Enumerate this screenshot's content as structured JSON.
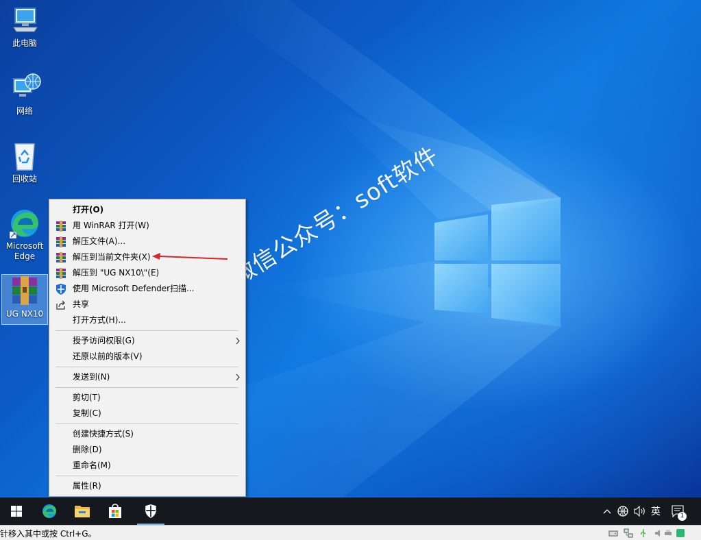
{
  "desktop": {
    "icons": [
      {
        "label": "此电脑",
        "icon": "this-pc-icon"
      },
      {
        "label": "网络",
        "icon": "network-icon"
      },
      {
        "label": "回收站",
        "icon": "recycle-bin-icon"
      },
      {
        "label": "Microsoft Edge",
        "icon": "edge-icon"
      },
      {
        "label": "UG NX10",
        "icon": "winrar-archive-icon"
      }
    ],
    "watermark": "微信公众号：soft软件"
  },
  "context_menu": {
    "items": [
      {
        "label": "打开(O)"
      },
      {
        "label": "用 WinRAR 打开(W)",
        "icon": "winrar-icon"
      },
      {
        "label": "解压文件(A)...",
        "icon": "winrar-icon"
      },
      {
        "label": "解压到当前文件夹(X)",
        "icon": "winrar-icon"
      },
      {
        "label": "解压到 \"UG NX10\\\"(E)",
        "icon": "winrar-icon"
      },
      {
        "label": "使用 Microsoft Defender扫描...",
        "icon": "defender-shield-icon"
      },
      {
        "label": "共享",
        "icon": "share-icon"
      },
      {
        "label": "打开方式(H)..."
      },
      {
        "label": "授予访问权限(G)",
        "submenu": true
      },
      {
        "label": "还原以前的版本(V)"
      },
      {
        "label": "发送到(N)",
        "submenu": true
      },
      {
        "label": "剪切(T)"
      },
      {
        "label": "复制(C)"
      },
      {
        "label": "创建快捷方式(S)"
      },
      {
        "label": "删除(D)"
      },
      {
        "label": "重命名(M)"
      },
      {
        "label": "属性(R)"
      }
    ]
  },
  "taskbar": {
    "buttons": [
      "start-icon",
      "edge-icon",
      "file-explorer-icon",
      "store-icon",
      "windows-security-icon"
    ],
    "tray": {
      "ime_label": "英",
      "notification_count": "1"
    }
  },
  "statusbar": {
    "text": "针移入其中或按 Ctrl+G。"
  },
  "colors": {
    "annotation_arrow": "#d8232a",
    "taskbar": "#15181d",
    "menu_bg": "#f2f2f2"
  }
}
